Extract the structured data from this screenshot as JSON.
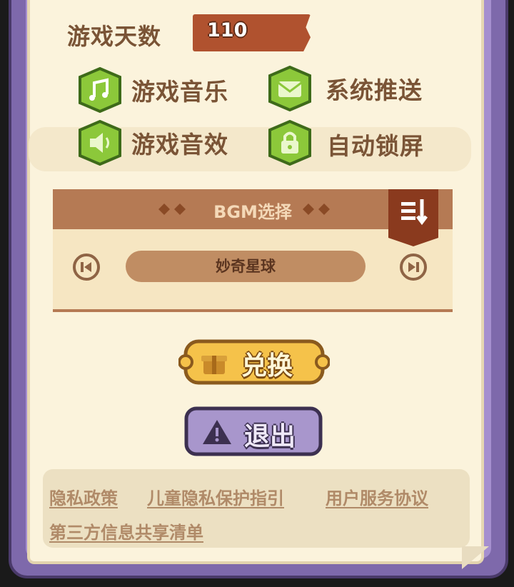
{
  "days": {
    "label": "游戏天数",
    "value": "110"
  },
  "settings": [
    {
      "label": "游戏音乐",
      "icon": "music-note-icon"
    },
    {
      "label": "系统推送",
      "icon": "envelope-icon"
    },
    {
      "label": "游戏音效",
      "icon": "speaker-icon"
    },
    {
      "label": "自动锁屏",
      "icon": "lock-icon"
    }
  ],
  "bgm": {
    "title": "BGM选择",
    "current_song": "妙奇星球"
  },
  "buttons": {
    "redeem": "兑换",
    "exit": "退出"
  },
  "links": [
    "隐私政策",
    "儿童隐私保护指引",
    "用户服务协议",
    "第三方信息共享清单"
  ],
  "colors": {
    "green": "#8cc83a",
    "brown": "#b57a54",
    "gold": "#f5c24a",
    "purple": "#a58fcf"
  }
}
